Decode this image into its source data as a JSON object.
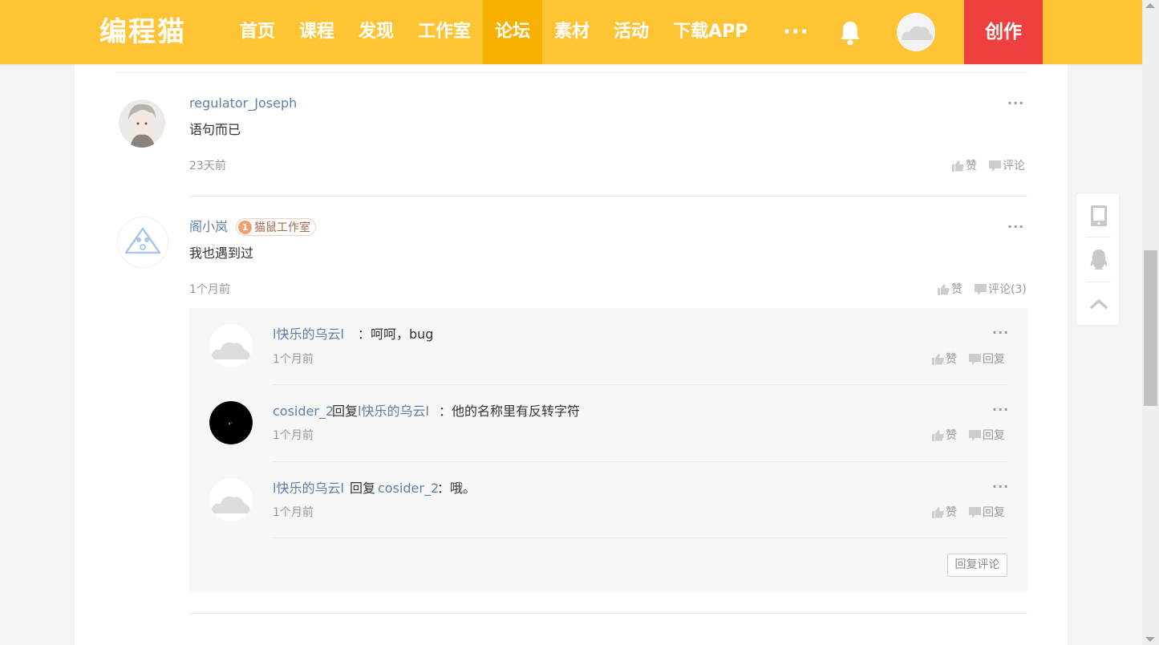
{
  "nav": {
    "logo": "编程猫",
    "items": [
      "首页",
      "课程",
      "发现",
      "工作室",
      "论坛",
      "素材",
      "活动",
      "下载APP"
    ],
    "active_index": 4,
    "more": "···",
    "create": "创作"
  },
  "comments": [
    {
      "user": "regulator_Joseph",
      "text": "语句而已",
      "time": "23天前",
      "like": "赞",
      "comment": "评论"
    },
    {
      "user": "阁小岚",
      "badge_level": "1",
      "badge_label": "猫鼠工作室",
      "text": "我也遇到过",
      "time": "1个月前",
      "like": "赞",
      "comment": "评论(3)"
    }
  ],
  "replies": [
    {
      "user": "l快乐的乌云l",
      "reply_word": "",
      "target": "",
      "text": "：呵呵，bug",
      "time": "1个月前",
      "like": "赞",
      "reply": "回复"
    },
    {
      "user": "cosider_2",
      "reply_word": "回复",
      "target": "l快乐的乌云l",
      "text": "：他的名称里有反转字符",
      "time": "1个月前",
      "like": "赞",
      "reply": "回复"
    },
    {
      "user": "l快乐的乌云l",
      "reply_word": "回复",
      "target": "cosider_2",
      "text": "：哦。",
      "time": "1个月前",
      "like": "赞",
      "reply": "回复"
    }
  ],
  "reply_comment_button": "回复评论",
  "colors": {
    "nav_bg": "#fec433",
    "nav_active": "#f5b000",
    "create_bg": "#ef4040",
    "username": "#5d80a7"
  }
}
